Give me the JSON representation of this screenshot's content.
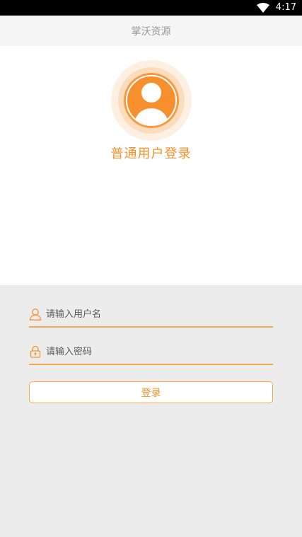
{
  "status_bar": {
    "time": "4:17",
    "wifi_icon": "wifi-icon"
  },
  "app": {
    "title": "掌沃资源"
  },
  "hero": {
    "avatar_icon": "user-avatar-icon",
    "heading": "普通用户登录"
  },
  "form": {
    "username": {
      "placeholder": "请输入用户名",
      "value": "",
      "icon": "user-outline-icon"
    },
    "password": {
      "placeholder": "请输入密码",
      "value": "",
      "icon": "lock-icon"
    },
    "submit_label": "登录"
  },
  "colors": {
    "accent": "#f4912c",
    "title_text": "#9a9a9a",
    "background": "#ececec"
  }
}
